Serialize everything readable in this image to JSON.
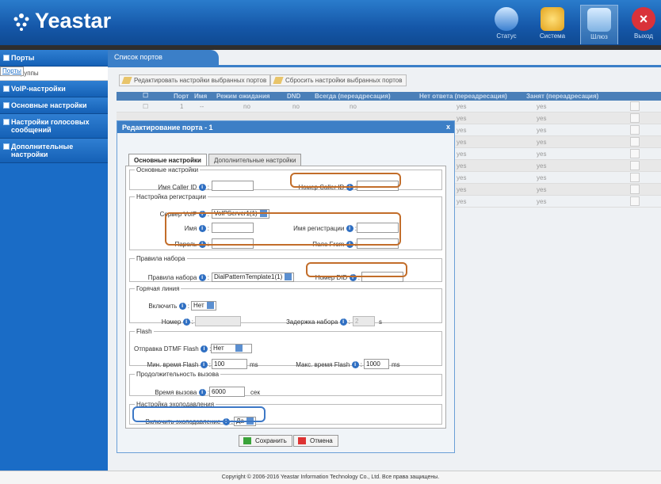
{
  "brand": {
    "name": "Yeastar"
  },
  "topnav": [
    {
      "label": "Статус",
      "icon": "monitor-icon"
    },
    {
      "label": "Система",
      "icon": "gear-icon"
    },
    {
      "label": "Шлюз",
      "icon": "gateway-icon"
    },
    {
      "label": "Выход",
      "icon": "exit-icon"
    }
  ],
  "sidebar": {
    "ports": "Порты",
    "ports_sub": "Порты",
    "groups": "Группы",
    "voip": "VoIP-настройки",
    "basic": "Основные настройки",
    "voice": "Настройки голосовых сообщений",
    "extra": "Дополнительные настройки"
  },
  "section": {
    "title": "Список портов"
  },
  "toolbar": {
    "edit": "Редактировать настройки выбранных портов",
    "reset": "Сбросить настройки выбранных портов"
  },
  "table": {
    "headers": [
      "Порт",
      "Имя",
      "Режим ожидания",
      "DND",
      "Всегда (переадресация)",
      "Нет ответа (переадресация)",
      "Занят (переадресация)"
    ],
    "row1": {
      "port": "1",
      "name": "--",
      "wait": "no",
      "dnd": "no",
      "always": "no"
    },
    "yes": "yes"
  },
  "modal": {
    "title": "Редактирование порта - 1",
    "close": "x",
    "tab_basic": "Основные настройки",
    "tab_extra": "Дополнительные настройки",
    "basic_group": {
      "legend": "Основные настройки",
      "caller_id_name": "Имя Caller ID",
      "caller_id_number": "Номер Caller ID"
    },
    "reg_group": {
      "legend": "Настройка регистрации",
      "server": "Сервер VoIP",
      "server_value": "VoIPServer1(1)",
      "name": "Имя",
      "reg_name": "Имя регистрации",
      "password": "Пароль",
      "from_field": "Поле From"
    },
    "dial_group": {
      "legend": "Правила набора",
      "rules": "Правила набора",
      "rules_value": "DialPatternTemplate1(1)",
      "did": "Номер DID"
    },
    "hotline_group": {
      "legend": "Горячая линия",
      "enable": "Включить",
      "enable_value": "Нет",
      "number": "Номер",
      "delay": "Задержка набора",
      "delay_value": "2",
      "delay_unit": "s"
    },
    "flash_group": {
      "legend": "Flash",
      "dtmf": "Отправка DTMF Flash",
      "dtmf_value": "Нет",
      "min": "Мин. время Flash",
      "min_value": "100",
      "max": "Макс. время Flash",
      "max_value": "1000",
      "unit": "ms"
    },
    "duration_group": {
      "legend": "Продолжительность вызова",
      "time": "Время вызова",
      "time_value": "6000",
      "unit": "сек"
    },
    "echo_group": {
      "legend": "Настройка эхоподавления",
      "enable": "Включить эхоподавление",
      "enable_value": "Да"
    },
    "save": "Сохранить",
    "cancel": "Отмена"
  },
  "footer": {
    "text": "Copyright © 2006-2016 Yeastar Information Technology Co., Ltd. Все права защищены."
  },
  "colors": {
    "header": "#1a63b4",
    "sidebar": "#1a6cc6",
    "highlight_orange": "#c26d2a",
    "highlight_blue": "#3d78c6"
  }
}
